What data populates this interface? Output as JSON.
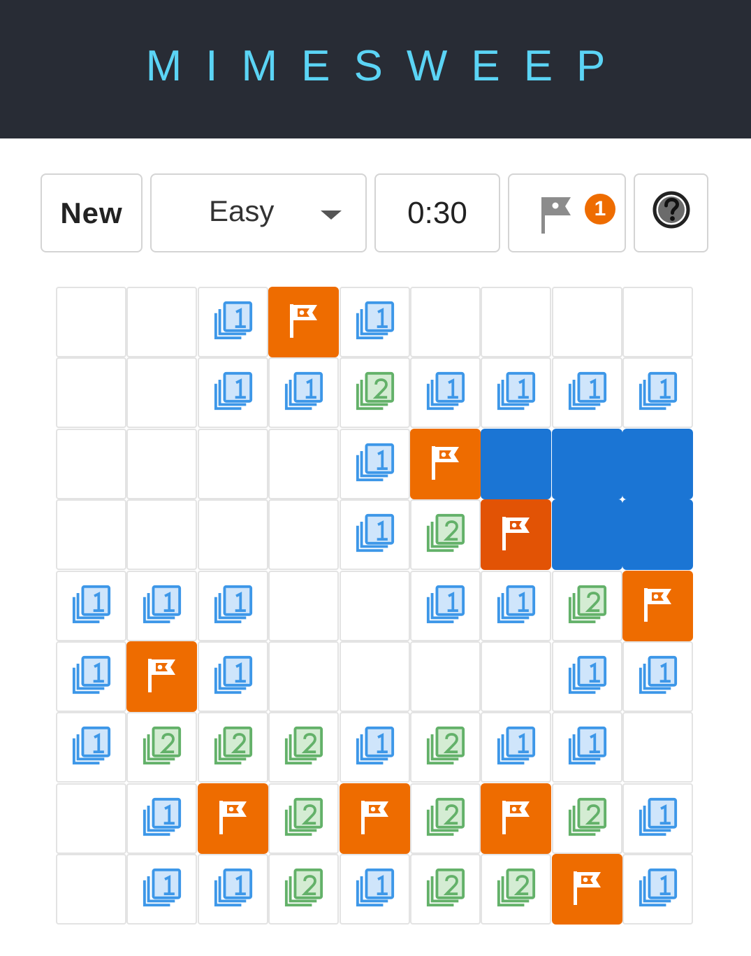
{
  "app": {
    "title": "MIMESWEEP"
  },
  "toolbar": {
    "new_label": "New",
    "difficulty": {
      "selected": "Easy"
    },
    "timer": "0:30",
    "flags_remaining": "1",
    "help_icon": "help-circle-icon",
    "flag_icon": "flag-icon"
  },
  "colors": {
    "header_bg": "#282c35",
    "title": "#5bd4f5",
    "flag_tile": "#ee6c00",
    "flag_tile_hit": "#e25305",
    "hidden_tile": "#1b75d4",
    "one": "#3d97e8",
    "two": "#63b169"
  },
  "board": {
    "rows": 9,
    "cols": 9,
    "legend": {
      "0": "empty",
      "1": "one",
      "2": "two",
      "F": "flag",
      "X": "flag-hit",
      "H": "hidden"
    },
    "cells": [
      [
        "0",
        "0",
        "1",
        "F",
        "1",
        "0",
        "0",
        "0",
        "0"
      ],
      [
        "0",
        "0",
        "1",
        "1",
        "2",
        "1",
        "1",
        "1",
        "1"
      ],
      [
        "0",
        "0",
        "0",
        "0",
        "1",
        "F",
        "H",
        "H",
        "H"
      ],
      [
        "0",
        "0",
        "0",
        "0",
        "1",
        "2",
        "X",
        "H",
        "H"
      ],
      [
        "1",
        "1",
        "1",
        "0",
        "0",
        "1",
        "1",
        "2",
        "F"
      ],
      [
        "1",
        "F",
        "1",
        "0",
        "0",
        "0",
        "0",
        "1",
        "1"
      ],
      [
        "1",
        "2",
        "2",
        "2",
        "1",
        "2",
        "1",
        "1",
        "0"
      ],
      [
        "0",
        "1",
        "F",
        "2",
        "F",
        "2",
        "F",
        "2",
        "1"
      ],
      [
        "0",
        "1",
        "1",
        "2",
        "1",
        "2",
        "2",
        "F",
        "1"
      ]
    ]
  }
}
